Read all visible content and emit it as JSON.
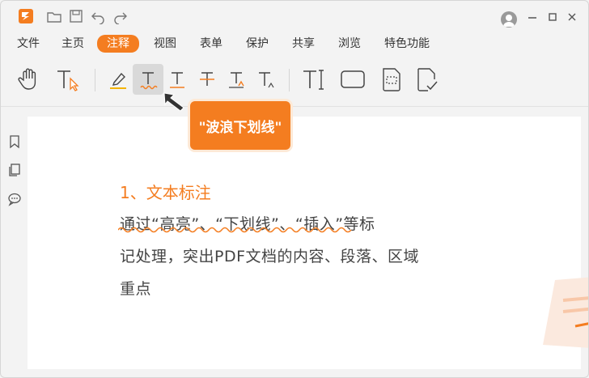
{
  "menu": {
    "items": [
      "文件",
      "主页",
      "注释",
      "视图",
      "表单",
      "保护",
      "共享",
      "浏览",
      "特色功能"
    ],
    "active": "注释"
  },
  "tooltip": {
    "label": "\"波浪下划线\""
  },
  "document": {
    "heading": "1、文本标注",
    "lines": [
      "通过“高亮”、“下划线”、“插入”等标",
      "记处理，突出PDF文档的内容、段落、区域",
      "重点"
    ]
  },
  "colors": {
    "accent": "#f47d20",
    "page": "#ffffff",
    "chrome": "#f3f3f3"
  },
  "icons": {
    "toolbar": [
      "hand-icon",
      "select-text-icon",
      "highlight-icon",
      "wavy-underline-icon",
      "underline-icon",
      "strikethrough-icon",
      "insert-text-icon",
      "replace-text-icon",
      "typewriter-icon",
      "textbox-icon",
      "note-icon",
      "stamp-icon"
    ],
    "rail": [
      "bookmark-icon",
      "pages-icon",
      "comment-icon"
    ]
  }
}
